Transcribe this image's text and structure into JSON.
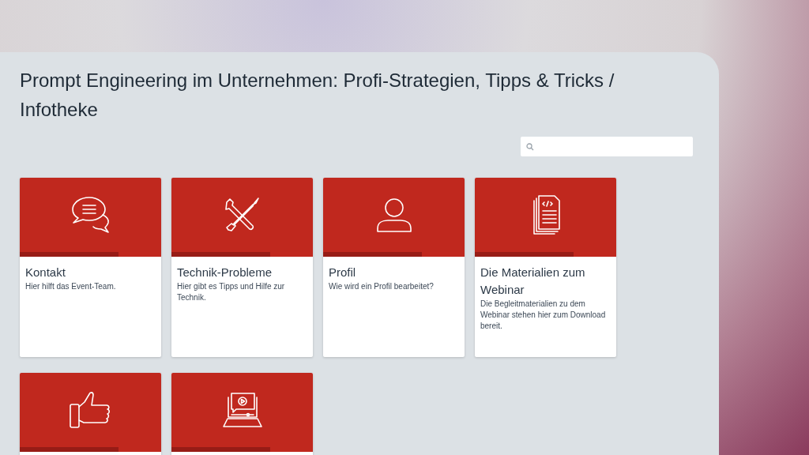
{
  "page": {
    "title": "Prompt Engineering im Unternehmen: Profi-Strategien, Tipps & Tricks / Infotheke"
  },
  "cards": [
    {
      "title": "Kontakt",
      "description": "Hier hilft das Event-Team.",
      "level": 0.7
    },
    {
      "title": "Technik-Probleme",
      "description": "Hier gibt es Tipps und Hilfe zur Technik.",
      "level": 0.7
    },
    {
      "title": "Profil",
      "description": "Wie wird ein Profil bearbeitet?",
      "level": 0.7
    },
    {
      "title": "Die Materialien zum Webinar",
      "description": "Die Begleitmaterialien zu dem Webinar stehen hier zum Download bereit.",
      "level": 0.7
    },
    {
      "level": 0.7
    },
    {
      "level": 0.7
    }
  ]
}
